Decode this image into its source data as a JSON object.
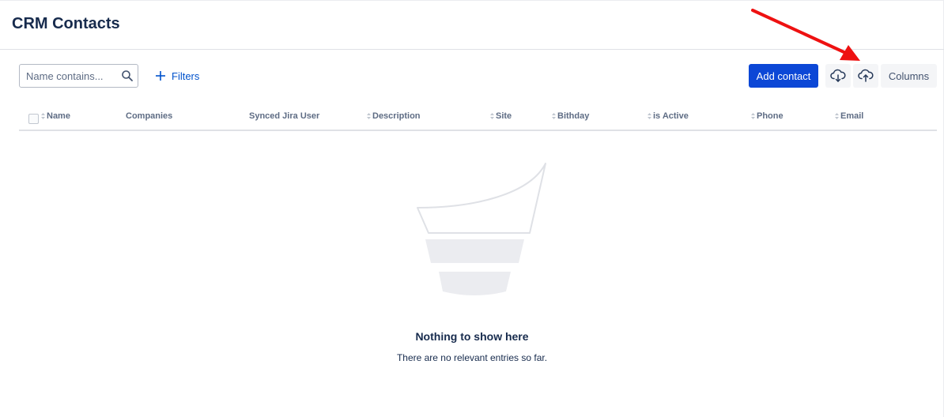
{
  "header": {
    "title": "CRM Contacts"
  },
  "toolbar": {
    "search": {
      "placeholder": "Name contains...",
      "value": "",
      "icon": "search-icon"
    },
    "filters_label": "Filters",
    "add_contact_label": "Add contact",
    "download_icon": "cloud-download-icon",
    "upload_icon": "cloud-upload-icon",
    "columns_label": "Columns"
  },
  "table": {
    "columns": [
      {
        "label": "Name",
        "sortable": true
      },
      {
        "label": "Companies",
        "sortable": false
      },
      {
        "label": "Synced Jira User",
        "sortable": false
      },
      {
        "label": "Description",
        "sortable": true
      },
      {
        "label": "Site",
        "sortable": true
      },
      {
        "label": "Bithday",
        "sortable": true
      },
      {
        "label": "is Active",
        "sortable": true
      },
      {
        "label": "Phone",
        "sortable": true
      },
      {
        "label": "Email",
        "sortable": true
      }
    ],
    "rows": []
  },
  "empty_state": {
    "title": "Nothing to show here",
    "description": "There are no relevant entries so far."
  },
  "colors": {
    "primary": "#0c47d6",
    "link": "#0052cc",
    "text": "#172b4d",
    "muted": "#5e6c84",
    "annotation_arrow": "#ee1111"
  }
}
